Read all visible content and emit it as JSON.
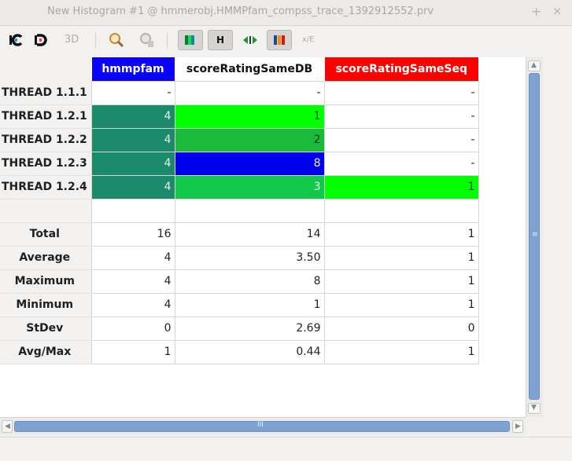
{
  "window": {
    "title": "New Histogram #1 @ hmmerobj.HMMPfam_compss_trace_1392912552.prv",
    "plus_icon": "+",
    "close_icon": "×"
  },
  "toolbar": {
    "buttons": [
      {
        "name": "control-window-icon",
        "label": ""
      },
      {
        "name": "data-window-icon",
        "label": ""
      },
      {
        "name": "3d-icon",
        "label": "3D"
      },
      {
        "name": "zoom-icon",
        "label": ""
      },
      {
        "name": "synchronize-icon",
        "label": ""
      },
      {
        "name": "view-color-icon",
        "label": ""
      },
      {
        "name": "hide-empty-icon",
        "label": "H"
      },
      {
        "name": "fit-columns-icon",
        "label": ""
      },
      {
        "name": "gradient-color-icon",
        "label": ""
      },
      {
        "name": "scientific-notation-icon",
        "label": "x/E"
      }
    ]
  },
  "table": {
    "columns": [
      {
        "label": "hmmpfam",
        "color": "#0a00ff"
      },
      {
        "label": "scoreRatingSameDB",
        "color": "#ffffff"
      },
      {
        "label": "scoreRatingSameSeq",
        "color": "#ff0000"
      }
    ],
    "rows": [
      {
        "label": "THREAD 1.1.1",
        "values": [
          "-",
          "-",
          "-"
        ]
      },
      {
        "label": "THREAD 1.2.1",
        "values": [
          "4",
          "1",
          "-"
        ]
      },
      {
        "label": "THREAD 1.2.2",
        "values": [
          "4",
          "2",
          "-"
        ]
      },
      {
        "label": "THREAD 1.2.3",
        "values": [
          "4",
          "8",
          "-"
        ]
      },
      {
        "label": "THREAD 1.2.4",
        "values": [
          "4",
          "3",
          "1"
        ]
      }
    ],
    "stats": [
      {
        "label": "Total",
        "values": [
          "16",
          "14",
          "1"
        ]
      },
      {
        "label": "Average",
        "values": [
          "4",
          "3.50",
          "1"
        ]
      },
      {
        "label": "Maximum",
        "values": [
          "4",
          "8",
          "1"
        ]
      },
      {
        "label": "Minimum",
        "values": [
          "4",
          "1",
          "1"
        ]
      },
      {
        "label": "StDev",
        "values": [
          "0",
          "2.69",
          "0"
        ]
      },
      {
        "label": "Avg/Max",
        "values": [
          "1",
          "0.44",
          "1"
        ]
      }
    ],
    "cell_colors": {
      "teal": "#1a8a6a",
      "lime": "#00ff00",
      "green": "#1aba3a",
      "blue": "#0000ee",
      "mid_green": "#11c84a"
    }
  },
  "scrollbars": {
    "grip": "III",
    "vgrip": "≡"
  }
}
